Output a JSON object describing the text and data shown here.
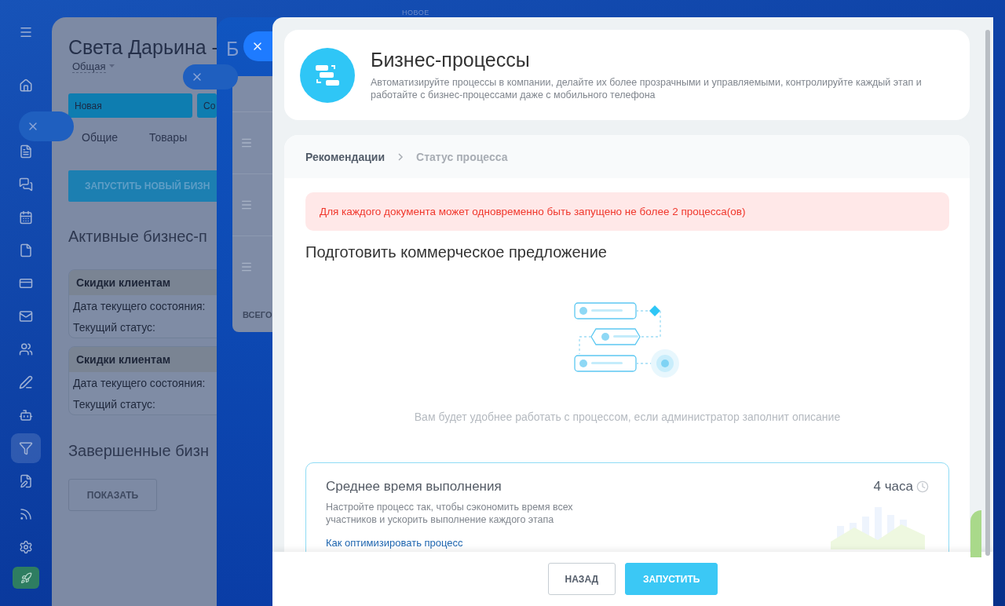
{
  "top_label": "НОВОЕ",
  "back_panel": {
    "title": "Света Дарьина -",
    "category": "Общая",
    "stages": [
      {
        "label": "Новая"
      },
      {
        "label": "Со"
      }
    ],
    "tabs": [
      {
        "label": "Общие"
      },
      {
        "label": "Товары"
      }
    ],
    "start_button": "ЗАПУСТИТЬ НОВЫЙ БИЗН",
    "active_heading": "Активные бизнес-п",
    "processes": [
      {
        "name": "Скидки клиентам",
        "date_label": "Дата текущего состояния:",
        "status_label": "Текущий статус:"
      },
      {
        "name": "Скидки клиентам",
        "date_label": "Дата текущего состояния:",
        "status_label": "Текущий статус:"
      }
    ],
    "completed_heading": "Завершенные бизн",
    "show_button": "ПОКАЗАТЬ"
  },
  "middle_panel": {
    "title": "Б",
    "footer": "ВСЕГО"
  },
  "slider": {
    "title": "Бизнес-процессы",
    "description": "Автоматизируйте процессы в компании, делайте их более прозрачными и управляемыми, контролируйте каждый этап и работайте с бизнес-процессами даже с мобильного телефона",
    "breadcrumbs": [
      {
        "label": "Рекомендации",
        "selected": true
      },
      {
        "label": "Статус процесса",
        "selected": false
      }
    ],
    "alert": "Для каждого документа может одновременно быть запущено не более 2 процесса(ов)",
    "process_title": "Подготовить коммерческое предложение",
    "empty_text": "Вам будет удобнее работать с процессом, если администратор заполнит описание",
    "stat": {
      "title": "Среднее время выполнения",
      "description": "Настройте процесс так, чтобы сэкономить время всех участников и ускорить выполнение каждого этапа",
      "value": "4 часа",
      "link": "Как оптимизировать процесс"
    },
    "buttons": [
      {
        "label": "НАЗАД",
        "kind": "secondary"
      },
      {
        "label": "ЗАПУСТИТЬ",
        "kind": "primary"
      }
    ]
  }
}
